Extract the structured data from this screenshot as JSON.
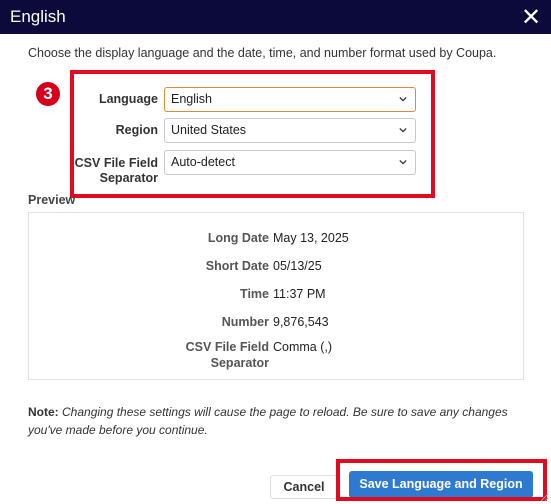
{
  "dialog": {
    "title": "English",
    "close_icon": "close-icon",
    "intro": "Choose the display language and the date, time, and number format used by Coupa."
  },
  "step_badge": "3",
  "form": {
    "language": {
      "label": "Language",
      "value": "English"
    },
    "region": {
      "label": "Region",
      "value": "United States"
    },
    "csv": {
      "label_line1": "CSV File Field",
      "label_line2": "Separator",
      "value": "Auto-detect"
    }
  },
  "preview": {
    "title": "Preview",
    "long_date": {
      "label": "Long Date",
      "value": "May 13, 2025"
    },
    "short_date": {
      "label": "Short Date",
      "value": "05/13/25"
    },
    "time": {
      "label": "Time",
      "value": "11:37 PM"
    },
    "number": {
      "label": "Number",
      "value": "9,876,543"
    },
    "csv": {
      "label_line1": "CSV File Field",
      "label_line2": "Separator",
      "value": "Comma (,)"
    }
  },
  "note": {
    "prefix": "Note:",
    "text": "Changing these settings will cause the page to reload. Be sure to save any changes you've made before you continue."
  },
  "buttons": {
    "cancel": "Cancel",
    "save": "Save Language and Region"
  },
  "colors": {
    "titlebar": "#0b0a3b",
    "highlight": "#e10a1e",
    "primary_button": "#2f7ad1",
    "active_select_border": "#e08a33"
  }
}
